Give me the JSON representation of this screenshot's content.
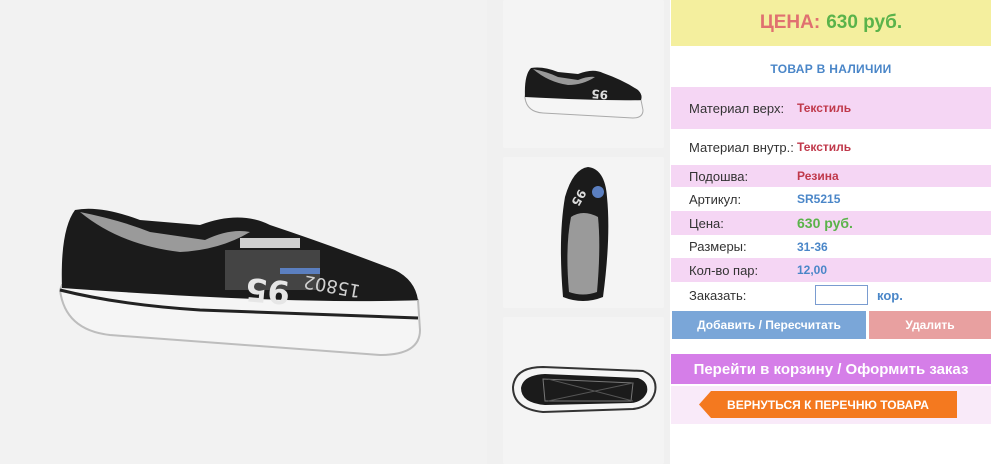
{
  "price_header": {
    "label": "ЦЕНА:",
    "value": "630 руб."
  },
  "stock_status": "ТОВАР В НАЛИЧИИ",
  "specs": [
    {
      "key": "Материал верх:",
      "value": "Текстиль"
    },
    {
      "key": "Материал внутр.:",
      "value": "Текстиль"
    },
    {
      "key": "Подошва:",
      "value": "Резина"
    },
    {
      "key": "Артикул:",
      "value": "SR5215"
    },
    {
      "key": "Цена:",
      "value": "630 руб."
    },
    {
      "key": "Размеры:",
      "value": "31-36"
    },
    {
      "key": "Кол-во пар:",
      "value": "12,00"
    }
  ],
  "order": {
    "label": "Заказать:",
    "input_value": "",
    "unit": "кор."
  },
  "buttons": {
    "add": "Добавить / Пересчитать",
    "delete": "Удалить",
    "cart": "Перейти в корзину / Оформить заказ",
    "back": "ВЕРНУТЬСЯ К ПЕРЕЧНЮ ТОВАРА"
  },
  "colors": {
    "price_bg": "#f4ef9e",
    "price_label": "#e07070",
    "price_value": "#5ab34a",
    "accent_blue": "#4a86c8",
    "row_pink": "#f5d6f4",
    "add_button": "#7aa6d8",
    "delete_button": "#e8a0a0",
    "cart_button": "#d57ee8",
    "back_button": "#f4791f"
  },
  "images": {
    "main": "shoe-side-view",
    "thumbs": [
      "shoe-side-view-thumb",
      "shoe-top-view-thumb",
      "shoe-sole-view-thumb"
    ]
  }
}
